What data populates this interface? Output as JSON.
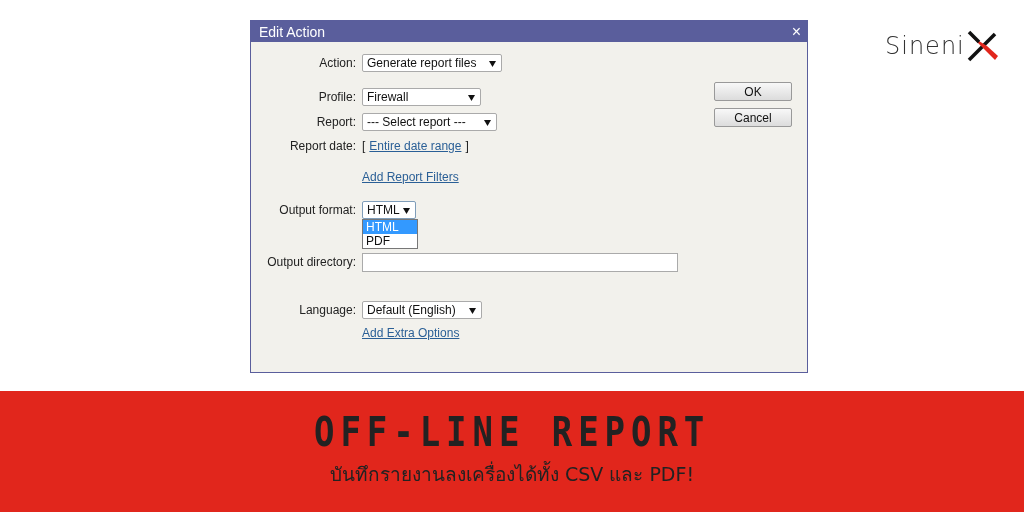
{
  "logo": {
    "text": "Sineni"
  },
  "dialog": {
    "title": "Edit Action",
    "close": "×",
    "buttons": [
      "OK",
      "Cancel"
    ],
    "rows": [
      {
        "kind": "select",
        "label": "Action:",
        "value": "Generate report files"
      },
      {
        "kind": "select",
        "label": "Profile:",
        "value": "Firewall"
      },
      {
        "kind": "select",
        "label": "Report:",
        "value": "--- Select report ---"
      },
      {
        "kind": "bracket-link",
        "label": "Report date:",
        "open": "[",
        "link": "Entire date range",
        "close": "]"
      },
      {
        "kind": "link",
        "link": "Add Report Filters"
      },
      {
        "kind": "select",
        "label": "Output format:",
        "value": "HTML",
        "expanded": true,
        "options": [
          {
            "label": "HTML",
            "selected": true
          },
          {
            "label": "PDF",
            "selected": false
          }
        ]
      },
      {
        "kind": "input",
        "label": "Output directory:",
        "value": ""
      },
      {
        "kind": "select",
        "label": "Language:",
        "value": "Default (English)"
      },
      {
        "kind": "link",
        "link": "Add Extra Options"
      }
    ]
  },
  "banner": {
    "title": "OFF-LINE REPORT",
    "subtitle": "บันทึกรายงานลงเครื่องได้ทั้ง CSV และ PDF!"
  }
}
